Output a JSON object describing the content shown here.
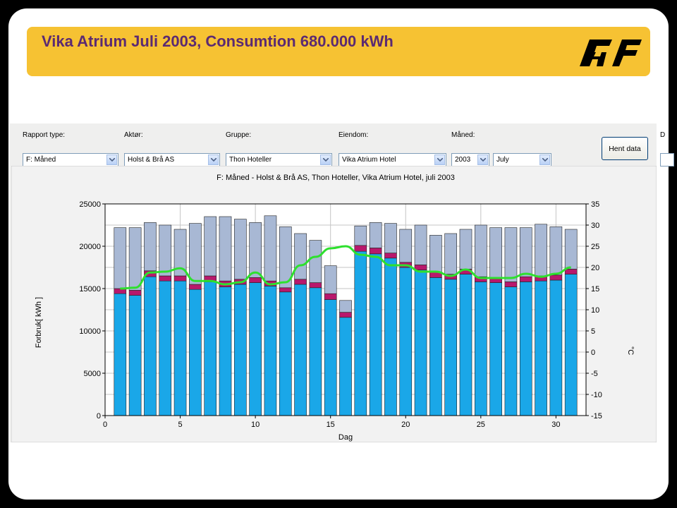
{
  "slide": {
    "title": "Vika Atrium Juli 2003, Consumtion 680.000 kWh",
    "logo": "af-logo"
  },
  "controls": {
    "rapport": {
      "label": "Rapport type:",
      "value": "F: Måned"
    },
    "aktor": {
      "label": "Aktør:",
      "value": "Holst & Brå AS"
    },
    "gruppe": {
      "label": "Gruppe:",
      "value": "Thon Hoteller"
    },
    "eiendom": {
      "label": "Eiendom:",
      "value": "Vika Atrium Hotel"
    },
    "maned": {
      "label": "Måned:",
      "year": "2003",
      "month": "July"
    },
    "cut_label": "D",
    "hent_label": "Hent data"
  },
  "chart_data": {
    "type": "bar",
    "title": "F: Måned - Holst & Brå AS, Thon Hoteller, Vika Atrium Hotel, juli 2003",
    "xlabel": "Dag",
    "ylabel": "Forbruk[ kWh ]",
    "y2label": "°C",
    "xlim": [
      0,
      32
    ],
    "ylim": [
      0,
      25000
    ],
    "y2lim": [
      -15,
      35
    ],
    "xticks": [
      0,
      5,
      10,
      15,
      20,
      25,
      30
    ],
    "yticks": [
      0,
      5000,
      10000,
      15000,
      20000,
      25000
    ],
    "y2ticks": [
      -15,
      -10,
      -5,
      0,
      5,
      10,
      15,
      20,
      25,
      30,
      35
    ],
    "stacked": true,
    "grid": true,
    "x": [
      1,
      2,
      3,
      4,
      5,
      6,
      7,
      8,
      9,
      10,
      11,
      12,
      13,
      14,
      15,
      16,
      17,
      18,
      19,
      20,
      21,
      22,
      23,
      24,
      25,
      26,
      27,
      28,
      29,
      30,
      31
    ],
    "series": [
      {
        "values": [
          14400,
          14200,
          16400,
          15900,
          15900,
          14900,
          15800,
          15200,
          15500,
          15700,
          15300,
          14600,
          15500,
          15100,
          13700,
          11600,
          19400,
          19100,
          18600,
          17500,
          17200,
          16300,
          16100,
          16700,
          15800,
          15700,
          15200,
          15800,
          15900,
          16000,
          16700
        ],
        "color": "#1aa7e8"
      },
      {
        "values": [
          600,
          600,
          700,
          600,
          600,
          600,
          700,
          700,
          600,
          600,
          600,
          500,
          600,
          600,
          700,
          600,
          700,
          700,
          600,
          600,
          600,
          600,
          600,
          600,
          600,
          600,
          600,
          600,
          600,
          600,
          600
        ],
        "color": "#b8186c"
      },
      {
        "values": [
          7200,
          7400,
          5700,
          6000,
          5500,
          7200,
          7000,
          7600,
          7100,
          6500,
          7700,
          7200,
          5400,
          5000,
          3300,
          1400,
          2300,
          3000,
          3500,
          3900,
          4700,
          4400,
          4800,
          4700,
          6100,
          5900,
          6400,
          5800,
          6100,
          5700,
          4700
        ],
        "color": "#a8b8d4"
      }
    ],
    "temperature": {
      "color": "#2ee02e",
      "values": [
        15,
        15.2,
        18.8,
        19,
        19.8,
        16.8,
        16.8,
        16,
        16.5,
        18.8,
        16,
        16.5,
        20.5,
        22.5,
        24.5,
        25,
        23,
        22.5,
        20.5,
        20.5,
        19,
        19,
        18,
        19.5,
        17.5,
        17.5,
        17.5,
        18.5,
        17.8,
        18.5,
        20
      ]
    }
  }
}
